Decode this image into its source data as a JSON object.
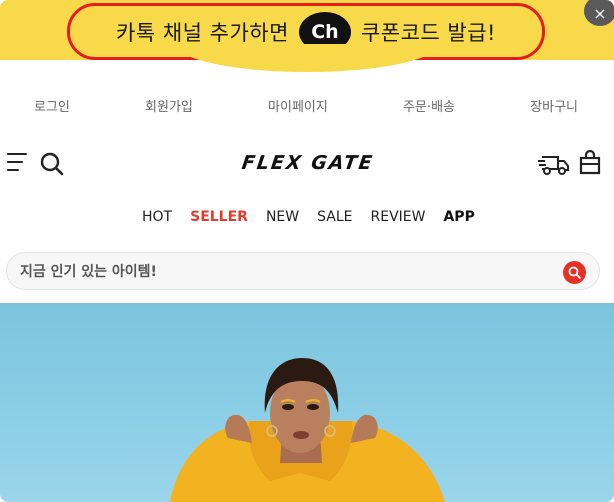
{
  "banner": {
    "text_left": "카톡 채널 추가하면",
    "channel_logo": "Ch",
    "text_right": "쿠폰코드 발급!",
    "close_label": "×",
    "bg_color": "#f7d94a",
    "border_color": "#e51d1d"
  },
  "top_links": [
    "로그인",
    "회원가입",
    "마이페이지",
    "주문·배송",
    "장바구니"
  ],
  "header": {
    "logo": "FLEX GATE",
    "icons": [
      "menu-icon",
      "search-icon",
      "delivery-truck-icon",
      "shopping-bag-icon"
    ]
  },
  "category_nav": [
    "HOT",
    "SELLER",
    "NEW",
    "SALE",
    "REVIEW",
    "APP"
  ],
  "search": {
    "placeholder": "지금 인기 있는 아이템!",
    "accent_color": "#e53226"
  },
  "hero": {
    "bg_color": "#8ccfe6"
  }
}
